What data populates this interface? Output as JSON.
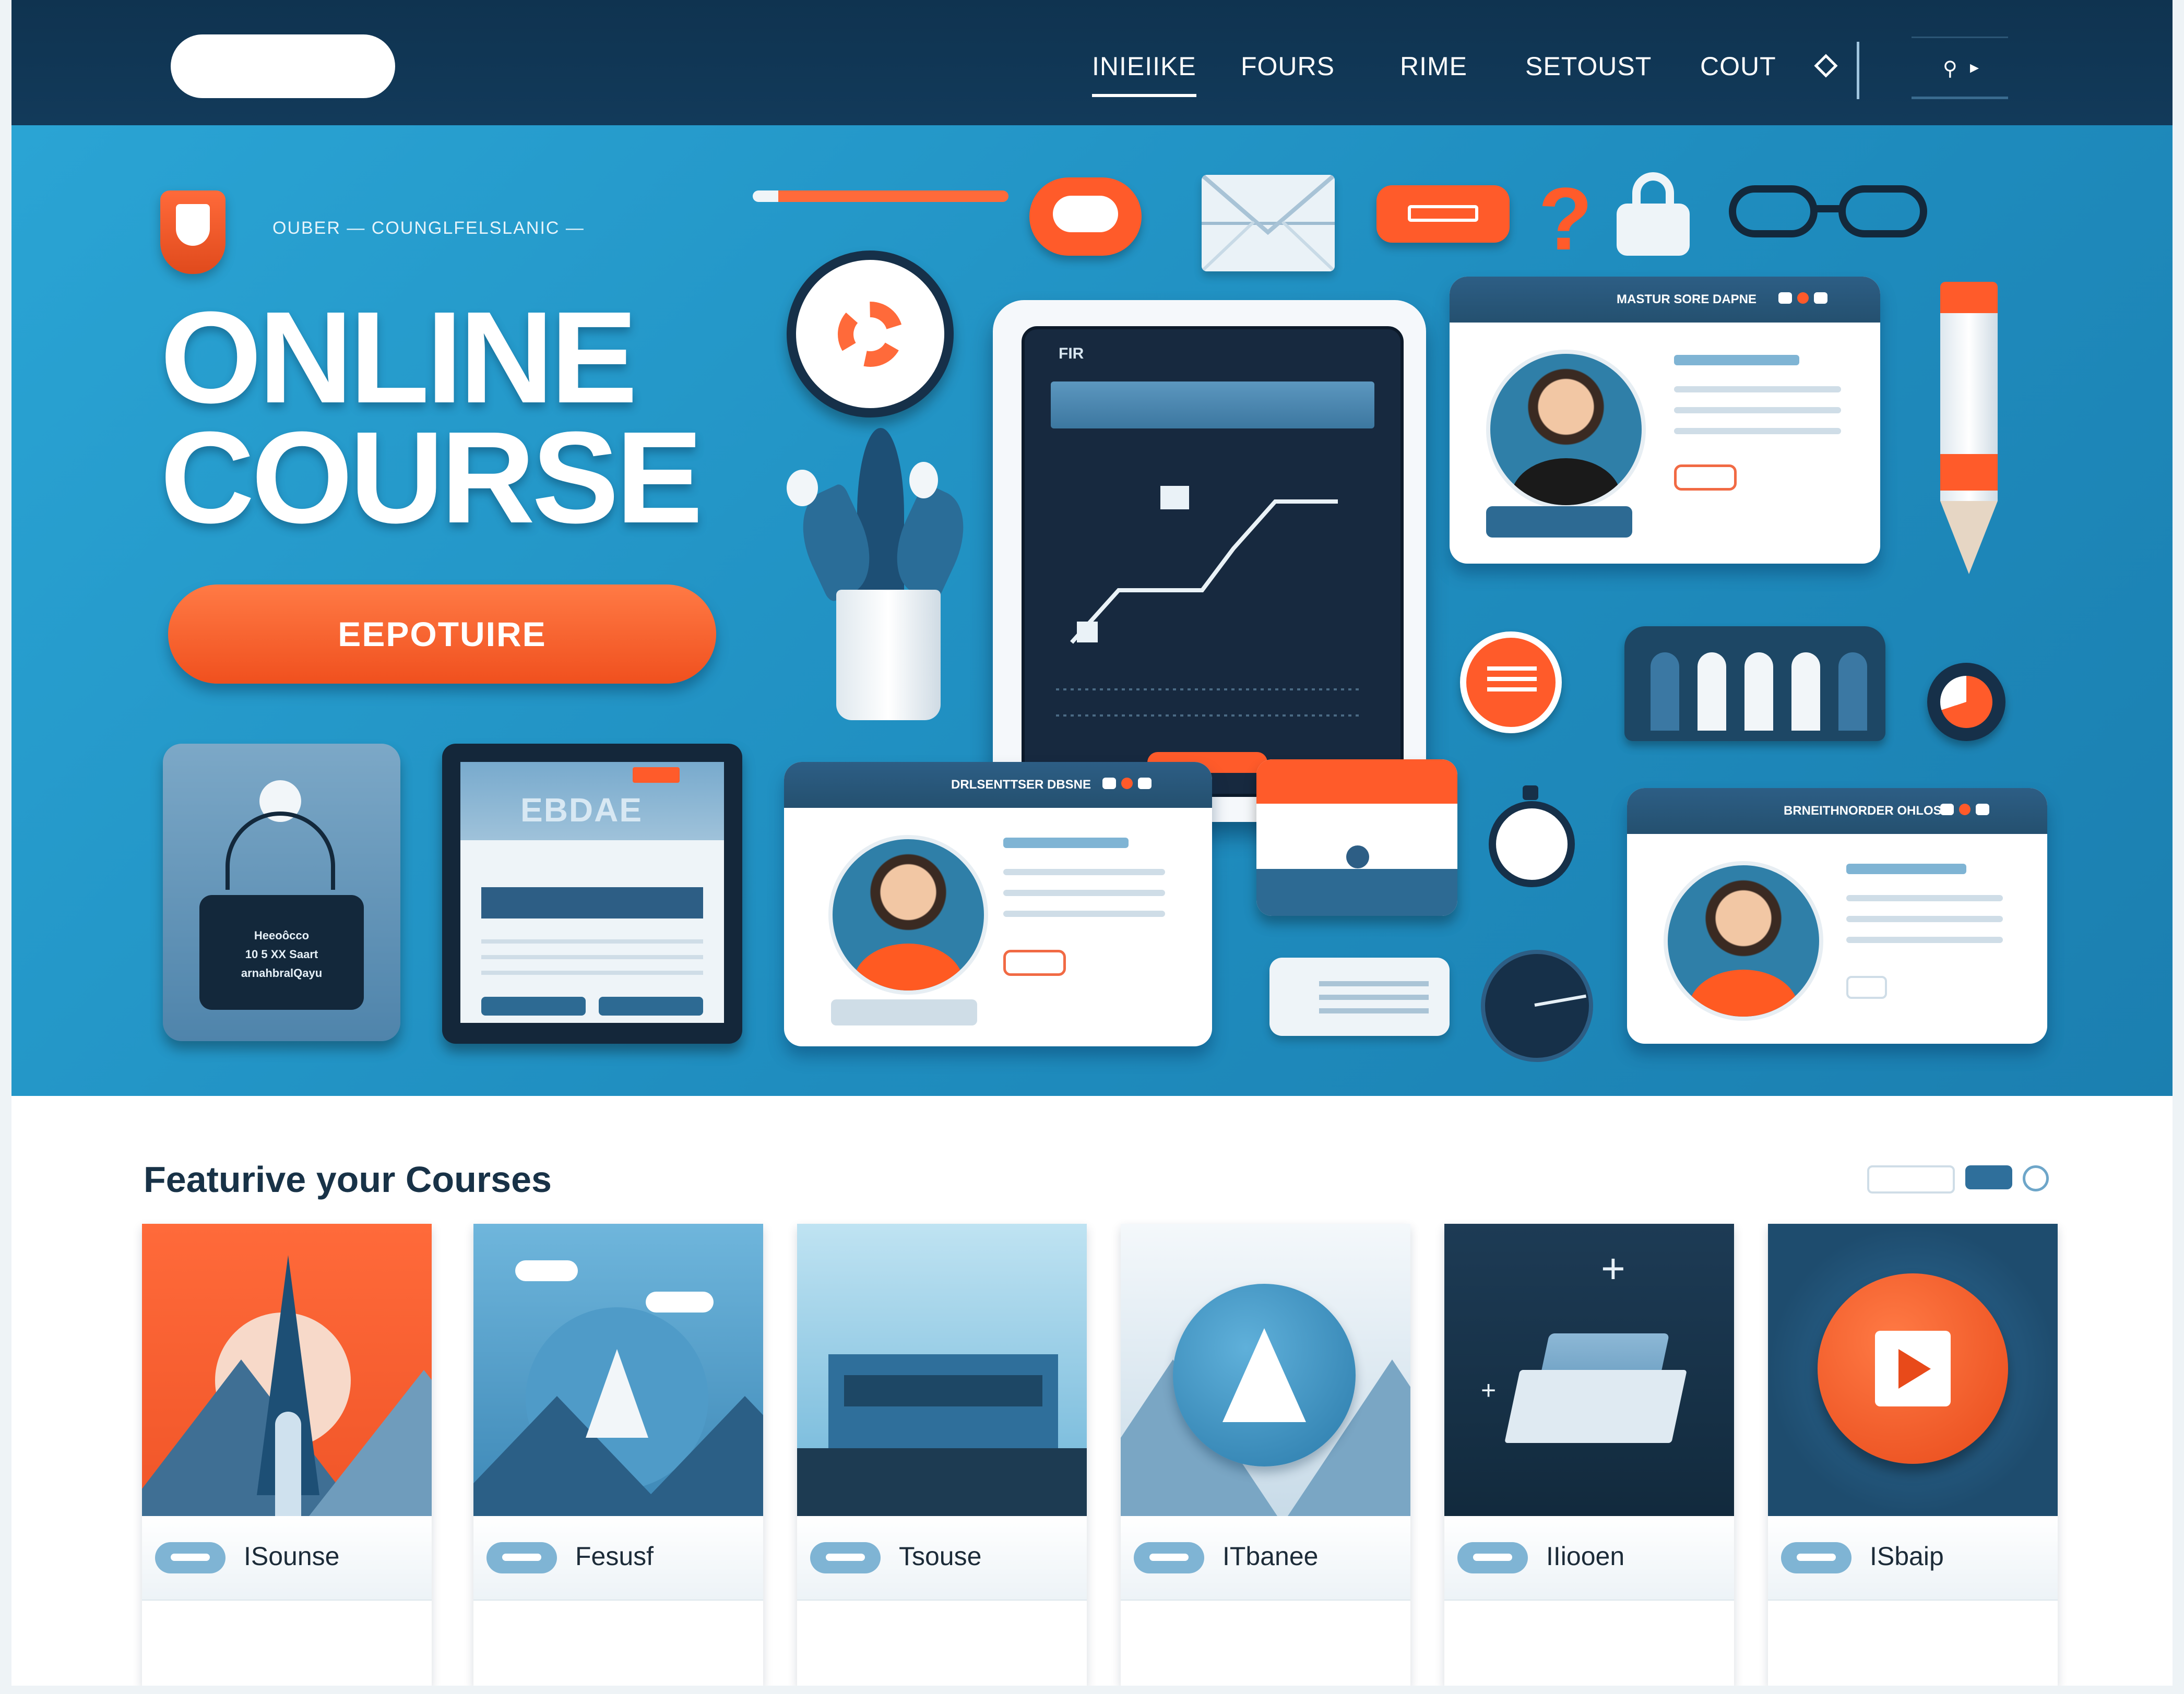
{
  "nav": {
    "links": [
      "INIEIIKE",
      "FOURS",
      "RIME",
      "SETOUST",
      "COUT"
    ],
    "active_index": 0
  },
  "hero": {
    "tagline": "OUBER — COUNGLFELSLANIC —",
    "title_line1": "ONLINE",
    "title_line2": "COURSE",
    "cta_label": "EEPOTUIRE",
    "tablet_label": "FIR",
    "profile_cards": [
      {
        "bar_title": "MASTUR SORE DAPNE"
      },
      {
        "bar_title": "DRLSENTTSER DBSNE"
      },
      {
        "bar_title": "BRNEITHNORDER OHLOS"
      }
    ],
    "bag_text": [
      "Heeoôcco",
      "10 5 XX Saart",
      "arnahbralQayu"
    ],
    "browser_title": "EBDAE"
  },
  "featured": {
    "title": "Featurive your Courses",
    "courses": [
      {
        "name": "ISounse",
        "theme": "orange"
      },
      {
        "name": "Fesusf",
        "theme": "blue"
      },
      {
        "name": "Tsouse",
        "theme": "sky"
      },
      {
        "name": "ITbanee",
        "theme": "light"
      },
      {
        "name": "IIiooen",
        "theme": "dark"
      },
      {
        "name": "ISbaip",
        "theme": "navy"
      }
    ]
  },
  "colors": {
    "nav_bg": "#0f3350",
    "hero_bg": "#2aa4d4",
    "accent": "#f0501e",
    "panel_blue": "#24506f"
  },
  "icons": [
    "pencil-icon",
    "clock-icon",
    "envelope-icon",
    "chat-icon",
    "question-icon",
    "lock-icon",
    "glasses-icon",
    "plant-icon",
    "calendar-icon",
    "stopwatch-icon",
    "gauge-icon",
    "bag-icon",
    "play-icon"
  ]
}
